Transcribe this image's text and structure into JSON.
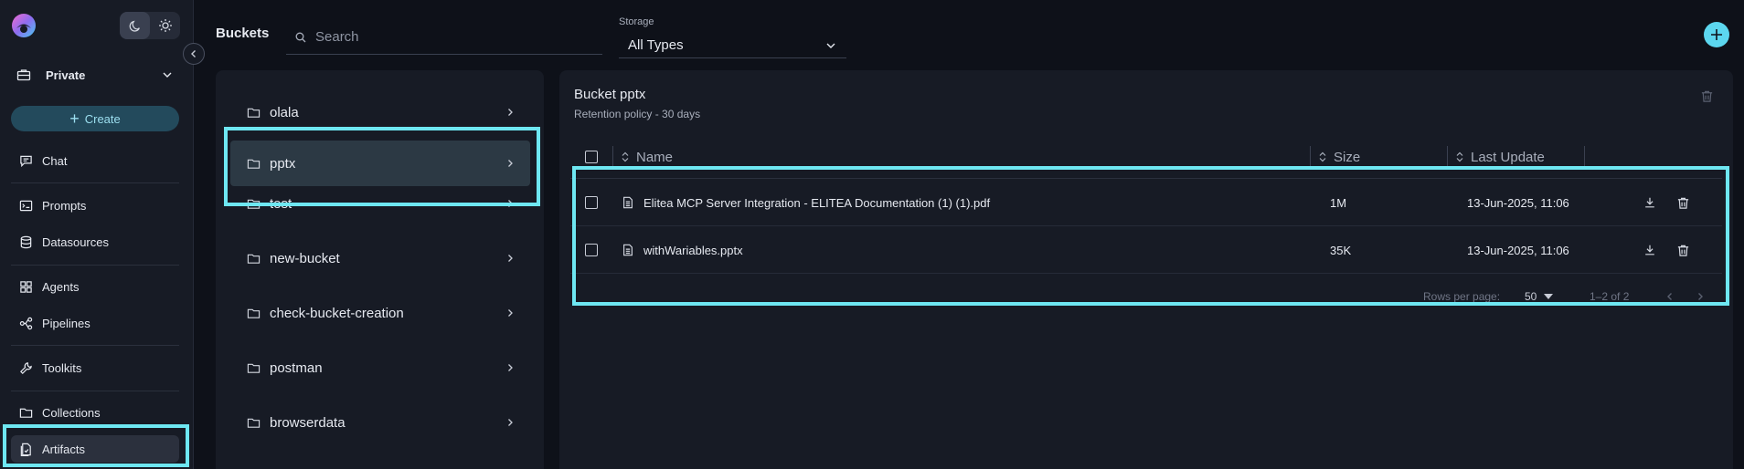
{
  "sidebar": {
    "project": "Private",
    "create_label": "Create",
    "nav": [
      {
        "label": "Chat",
        "icon": "chat-icon"
      },
      {
        "label": "Prompts",
        "icon": "prompts-icon"
      },
      {
        "label": "Datasources",
        "icon": "datasources-icon"
      },
      {
        "label": "Agents",
        "icon": "agents-icon"
      },
      {
        "label": "Pipelines",
        "icon": "pipelines-icon"
      },
      {
        "label": "Toolkits",
        "icon": "toolkits-icon"
      },
      {
        "label": "Collections",
        "icon": "collections-icon"
      },
      {
        "label": "Artifacts",
        "icon": "artifacts-icon",
        "active": true
      }
    ]
  },
  "header": {
    "title": "Buckets",
    "search_placeholder": "Search",
    "storage_label": "Storage",
    "storage_value": "All Types"
  },
  "buckets": [
    {
      "name": "olala"
    },
    {
      "name": "pptx",
      "selected": true
    },
    {
      "name": "test"
    },
    {
      "name": "new-bucket"
    },
    {
      "name": "check-bucket-creation"
    },
    {
      "name": "postman"
    },
    {
      "name": "browserdata"
    }
  ],
  "detail": {
    "title": "Bucket pptx",
    "retention": "Retention policy - 30 days",
    "columns": {
      "name": "Name",
      "size": "Size",
      "updated": "Last Update"
    },
    "files": [
      {
        "name": "Elitea MCP Server Integration - ELITEA Documentation (1) (1).pdf",
        "size": "1M",
        "updated": "13-Jun-2025, 11:06"
      },
      {
        "name": "withWariables.pptx",
        "size": "35K",
        "updated": "13-Jun-2025, 11:06"
      }
    ],
    "pagination": {
      "rows_label": "Rows per page:",
      "rows_value": "50",
      "range": "1–2 of 2"
    }
  },
  "colors": {
    "accent": "#5cd7ef",
    "highlight": "#6ee7f2",
    "background": "#0e1119",
    "panel": "#171b25"
  }
}
